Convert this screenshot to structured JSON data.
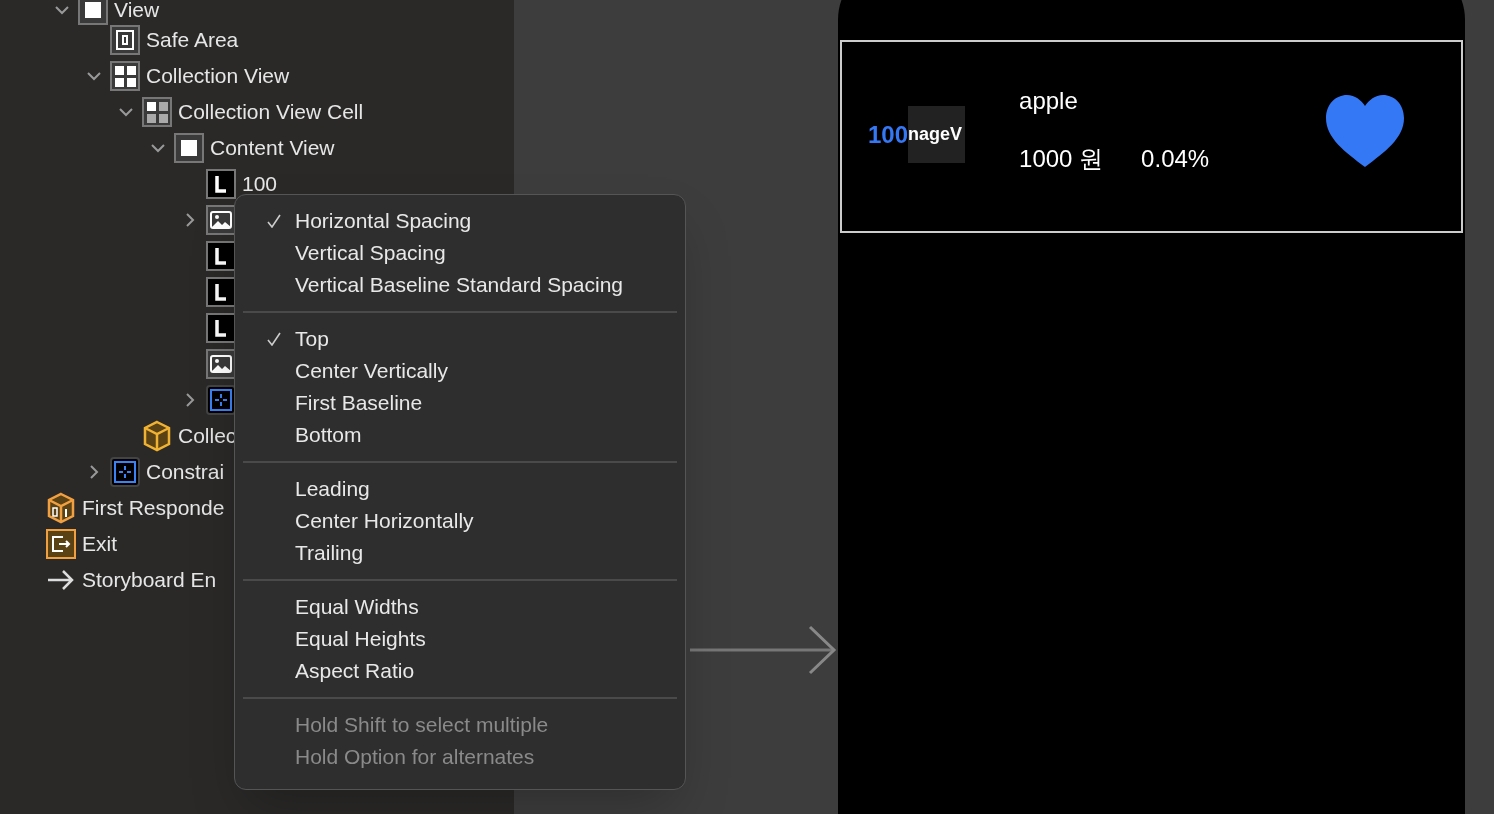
{
  "outline": [
    {
      "kind": "view",
      "label": "View",
      "expanded": true,
      "children": [
        {
          "kind": "safearea",
          "label": "Safe Area"
        },
        {
          "kind": "collection",
          "label": "Collection View",
          "expanded": true,
          "children": [
            {
              "kind": "cell",
              "label": "Collection View Cell",
              "expanded": true,
              "children": [
                {
                  "kind": "view",
                  "label": "Content View",
                  "expanded": true,
                  "children": [
                    {
                      "kind": "label",
                      "label": "100"
                    },
                    {
                      "kind": "image",
                      "expanded": false
                    },
                    {
                      "kind": "label"
                    },
                    {
                      "kind": "label"
                    },
                    {
                      "kind": "label"
                    },
                    {
                      "kind": "image"
                    },
                    {
                      "kind": "constraints",
                      "expanded": false
                    }
                  ]
                }
              ]
            },
            {
              "kind": "object",
              "label": "Collec"
            }
          ]
        },
        {
          "kind": "constraints",
          "label": "Constrai",
          "expanded": false
        }
      ]
    }
  ],
  "scene_objects": [
    {
      "kind": "responder",
      "label": "First Responde"
    },
    {
      "kind": "exit",
      "label": "Exit"
    },
    {
      "kind": "entry",
      "label": "Storyboard En"
    }
  ],
  "menu": {
    "sections": [
      {
        "items": [
          {
            "label": "Horizontal Spacing",
            "checked": true
          },
          {
            "label": "Vertical Spacing",
            "checked": false
          },
          {
            "label": "Vertical Baseline Standard Spacing",
            "checked": false
          }
        ]
      },
      {
        "items": [
          {
            "label": "Top",
            "checked": true
          },
          {
            "label": "Center Vertically",
            "checked": false
          },
          {
            "label": "First Baseline",
            "checked": false
          },
          {
            "label": "Bottom",
            "checked": false
          }
        ]
      },
      {
        "items": [
          {
            "label": "Leading",
            "checked": false
          },
          {
            "label": "Center Horizontally",
            "checked": false
          },
          {
            "label": "Trailing",
            "checked": false
          }
        ]
      },
      {
        "items": [
          {
            "label": "Equal Widths",
            "checked": false
          },
          {
            "label": "Equal Heights",
            "checked": false
          },
          {
            "label": "Aspect Ratio",
            "checked": false
          }
        ]
      },
      {
        "items": [
          {
            "label": "Hold Shift to select multiple",
            "disabled": true
          },
          {
            "label": "Hold Option for alternates",
            "disabled": true
          }
        ]
      }
    ]
  },
  "cell": {
    "rank": "100",
    "image_text": "nageV",
    "name": "apple",
    "price": "1000 원",
    "change": "0.04%"
  }
}
